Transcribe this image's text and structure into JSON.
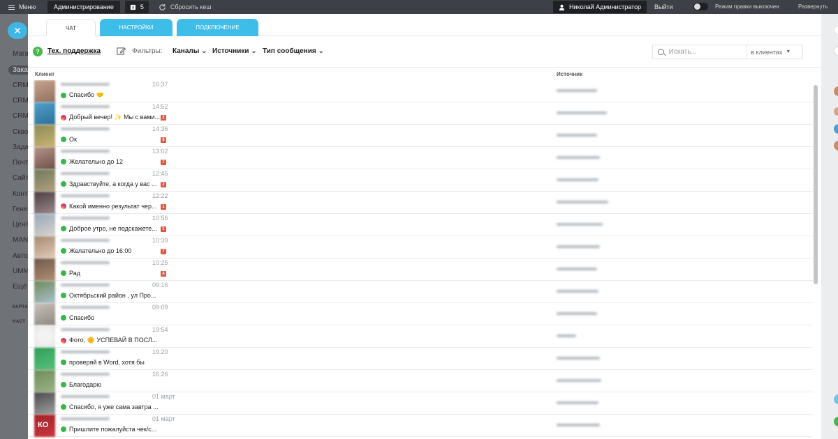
{
  "topbar": {
    "menu_label": "Меню",
    "admin_label": "Администрирование",
    "notif_count": "5",
    "reset_cache_label": "Сбросить кеш",
    "user_name": "Николай Администратор",
    "logout_label": "Выйти",
    "edit_mode_label": "Режим правки выключен",
    "expand_label": "Развернуть"
  },
  "bg_nav": {
    "items": [
      "Мага",
      "Зака",
      "CRM",
      "CRM",
      "CRM",
      "Скво",
      "Зада",
      "Почт",
      "Сайт",
      "Конт",
      "Гене",
      "Цент",
      "MAN",
      "Авто",
      "UMM",
      "Ещё"
    ],
    "small_items": [
      "КАРТА",
      "НАСТ"
    ]
  },
  "tabs": [
    "ЧАТ",
    "НАСТРОЙКИ",
    "ПОДКЛЮЧЕНИЕ"
  ],
  "filters": {
    "support_label": "Тех. поддержка",
    "filters_label": "Фильтры:",
    "channels_label": "Каналы",
    "sources_label": "Источники",
    "msg_type_label": "Тип сообщения"
  },
  "search": {
    "placeholder": "Искать...",
    "scope_label": "в клиентах"
  },
  "table": {
    "col_client": "Клиент",
    "col_source": "Источник"
  },
  "rows": [
    {
      "time": "16:37",
      "channel": "whatsapp",
      "message": "Спасибо 🤝",
      "badge": ""
    },
    {
      "time": "14:52",
      "channel": "instagram",
      "message": "Добрый вечер! ✨ Мы с вами...",
      "badge": "2"
    },
    {
      "time": "14:36",
      "channel": "whatsapp",
      "message": "Ок",
      "badge": "8"
    },
    {
      "time": "13:02",
      "channel": "whatsapp",
      "message": "Желательно до 12",
      "badge": "7"
    },
    {
      "time": "12:45",
      "channel": "whatsapp",
      "message": "Здравствуйте, а когда у вас ...",
      "badge": "2"
    },
    {
      "time": "12:22",
      "channel": "instagram",
      "message": "Какой именно результат чер...",
      "badge": "1"
    },
    {
      "time": "10:56",
      "channel": "whatsapp",
      "message": "Доброе утро, не подскажете...",
      "badge": "1"
    },
    {
      "time": "10:39",
      "channel": "whatsapp",
      "message": "Желательно до 16:00",
      "badge": "7"
    },
    {
      "time": "10:25",
      "channel": "whatsapp",
      "message": "Рад",
      "badge": "4"
    },
    {
      "time": "09:16",
      "channel": "whatsapp",
      "message": "Октябрьский район , ул Про...",
      "badge": ""
    },
    {
      "time": "09:09",
      "channel": "whatsapp",
      "message": "Спасибо",
      "badge": ""
    },
    {
      "time": "19:54",
      "channel": "instagram",
      "message": "Фото, 🌼 УСПЕВАЙ В ПОСЛ...",
      "badge": ""
    },
    {
      "time": "19:20",
      "channel": "whatsapp",
      "message": "проверяй в Word, хотя бы",
      "badge": ""
    },
    {
      "time": "16:26",
      "channel": "whatsapp",
      "message": "Благодарю",
      "badge": ""
    },
    {
      "time": "01 март",
      "channel": "whatsapp",
      "message": "Спасибо, я уже сама завтра ...",
      "badge": ""
    },
    {
      "time": "01 март",
      "channel": "whatsapp",
      "message": "Пришлите пожалуйста чек/с...",
      "badge": ""
    }
  ],
  "avatar_labels": [
    "КО"
  ],
  "colors": {
    "accent": "#3fbde9",
    "whatsapp": "#39b54a",
    "badge": "#e4573f",
    "topbar": "#3d4046"
  }
}
